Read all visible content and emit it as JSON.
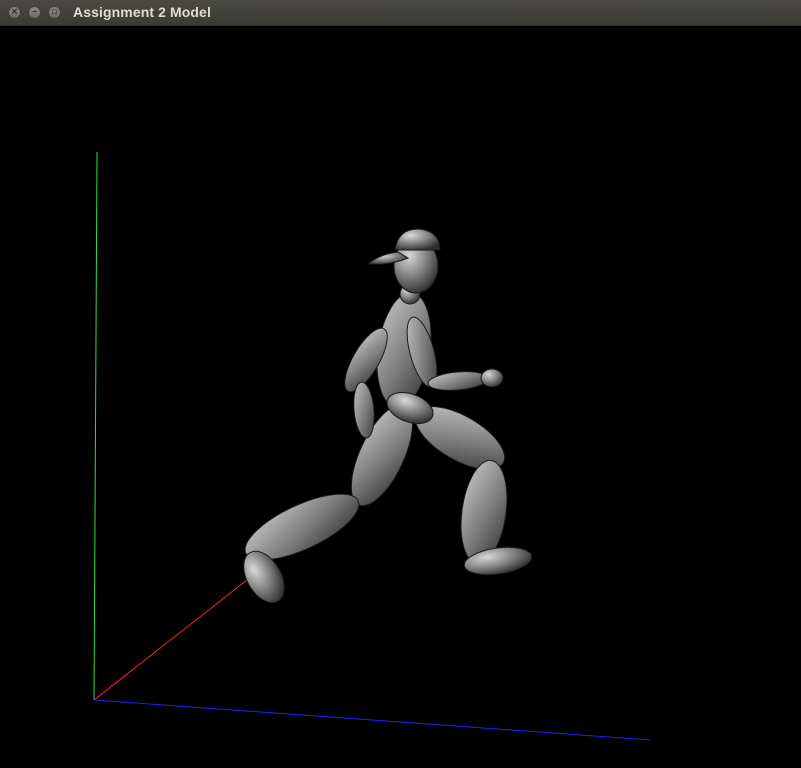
{
  "window": {
    "title": "Assignment 2 Model",
    "buttons": {
      "close_icon": "close-icon",
      "minimize_icon": "minimize-icon",
      "maximize_icon": "maximize-icon"
    }
  },
  "scene": {
    "background": "#000000",
    "axis_colors": {
      "x": "#ff2020",
      "y": "#33dd33",
      "z": "#2020ff"
    },
    "model_color": "#9a9a9a"
  }
}
